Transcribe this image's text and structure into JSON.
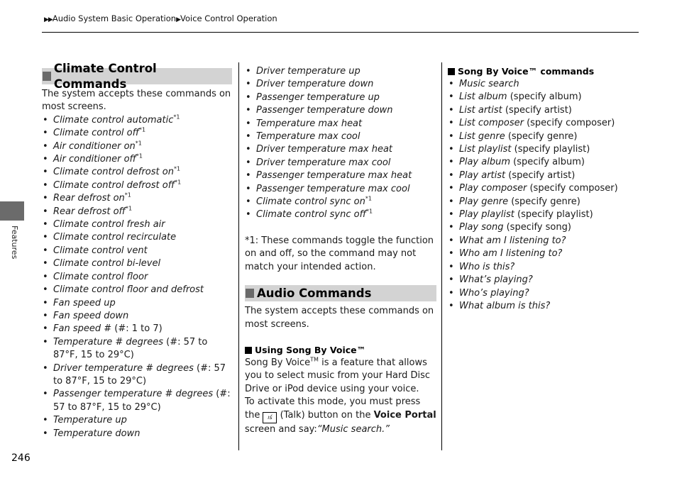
{
  "breadcrumb": {
    "prefix_arrows": "▶▶",
    "items": [
      "Audio System Basic Operation",
      "Voice Control Operation"
    ],
    "separator": "▶"
  },
  "side_tab": {
    "label": "Features"
  },
  "page_number": "246",
  "climate": {
    "heading": "Climate Control Commands",
    "intro": "The system accepts these commands on most screens.",
    "items": [
      {
        "cmd": "Climate control automatic",
        "sup": "*1",
        "note": ""
      },
      {
        "cmd": "Climate control off",
        "sup": "*1",
        "note": ""
      },
      {
        "cmd": "Air conditioner on",
        "sup": "*1",
        "note": ""
      },
      {
        "cmd": "Air conditioner off",
        "sup": "*1",
        "note": ""
      },
      {
        "cmd": "Climate control defrost on",
        "sup": "*1",
        "note": ""
      },
      {
        "cmd": "Climate control defrost off",
        "sup": "*1",
        "note": ""
      },
      {
        "cmd": "Rear defrost on",
        "sup": "*1",
        "note": ""
      },
      {
        "cmd": "Rear defrost off",
        "sup": "*1",
        "note": ""
      },
      {
        "cmd": "Climate control fresh air",
        "sup": "",
        "note": ""
      },
      {
        "cmd": "Climate control recirculate",
        "sup": "",
        "note": ""
      },
      {
        "cmd": "Climate control vent",
        "sup": "",
        "note": ""
      },
      {
        "cmd": "Climate control bi-level",
        "sup": "",
        "note": ""
      },
      {
        "cmd": "Climate control floor",
        "sup": "",
        "note": ""
      },
      {
        "cmd": "Climate control floor and defrost",
        "sup": "",
        "note": ""
      },
      {
        "cmd": "Fan speed up",
        "sup": "",
        "note": ""
      },
      {
        "cmd": "Fan speed down",
        "sup": "",
        "note": ""
      },
      {
        "cmd": "Fan speed #",
        "sup": "",
        "note": " (#: 1 to 7)"
      },
      {
        "cmd": "Temperature # degrees",
        "sup": "",
        "note": " (#: 57 to 87°F, 15 to 29°C)"
      },
      {
        "cmd": "Driver temperature # degrees",
        "sup": "",
        "note": " (#: 57 to 87°F, 15 to 29°C)"
      },
      {
        "cmd": "Passenger temperature # degrees",
        "sup": "",
        "note": " (#: 57 to 87°F, 15 to 29°C)"
      },
      {
        "cmd": "Temperature up",
        "sup": "",
        "note": ""
      },
      {
        "cmd": "Temperature down",
        "sup": "",
        "note": ""
      }
    ],
    "items_continued": [
      {
        "cmd": "Driver temperature up",
        "sup": ""
      },
      {
        "cmd": "Driver temperature down",
        "sup": ""
      },
      {
        "cmd": "Passenger temperature up",
        "sup": ""
      },
      {
        "cmd": "Passenger temperature down",
        "sup": ""
      },
      {
        "cmd": "Temperature max heat",
        "sup": ""
      },
      {
        "cmd": "Temperature max cool",
        "sup": ""
      },
      {
        "cmd": "Driver temperature max heat",
        "sup": ""
      },
      {
        "cmd": "Driver temperature max cool",
        "sup": ""
      },
      {
        "cmd": "Passenger temperature max heat",
        "sup": ""
      },
      {
        "cmd": "Passenger temperature max cool",
        "sup": ""
      },
      {
        "cmd": "Climate control sync on",
        "sup": "*1"
      },
      {
        "cmd": "Climate control sync off",
        "sup": "*1"
      }
    ],
    "footnote": "*1: These commands toggle the function on and off, so the command may not match your intended action."
  },
  "audio": {
    "heading": "Audio Commands",
    "intro": "The system accepts these commands on most screens.",
    "using_sbv": {
      "subheading": "Using Song By Voice™",
      "p1_a": "Song By Voice",
      "p1_tm": "TM",
      "p1_b": " is a feature that allows you to select music from your Hard Disc Drive or iPod device using your voice.",
      "p2_a": "To activate this mode, you must press the ",
      "talk_icon": "talk-icon",
      "p2_b": " (Talk) button on the ",
      "p2_bold": "Voice Portal",
      "p2_c": " screen and say:",
      "p2_quote": "“Music search.”"
    },
    "sbv_commands": {
      "subheading": "Song By Voice™ commands",
      "items": [
        {
          "cmd": "Music search",
          "note": ""
        },
        {
          "cmd": "List album",
          "note": " (specify album)"
        },
        {
          "cmd": "List artist",
          "note": " (specify artist)"
        },
        {
          "cmd": "List composer",
          "note": " (specify composer)"
        },
        {
          "cmd": "List genre",
          "note": " (specify genre)"
        },
        {
          "cmd": "List playlist",
          "note": " (specify playlist)"
        },
        {
          "cmd": "Play album",
          "note": " (specify album)"
        },
        {
          "cmd": "Play artist",
          "note": " (specify artist)"
        },
        {
          "cmd": "Play composer",
          "note": " (specify composer)"
        },
        {
          "cmd": "Play genre",
          "note": " (specify genre)"
        },
        {
          "cmd": "Play playlist",
          "note": " (specify playlist)"
        },
        {
          "cmd": "Play song",
          "note": " (specify song)"
        },
        {
          "cmd": "What am I listening to?",
          "note": ""
        },
        {
          "cmd": "Who am I listening to?",
          "note": ""
        },
        {
          "cmd": "Who is this?",
          "note": ""
        },
        {
          "cmd": "What’s playing?",
          "note": ""
        },
        {
          "cmd": "Who’s playing?",
          "note": ""
        },
        {
          "cmd": "What album is this?",
          "note": ""
        }
      ]
    }
  }
}
